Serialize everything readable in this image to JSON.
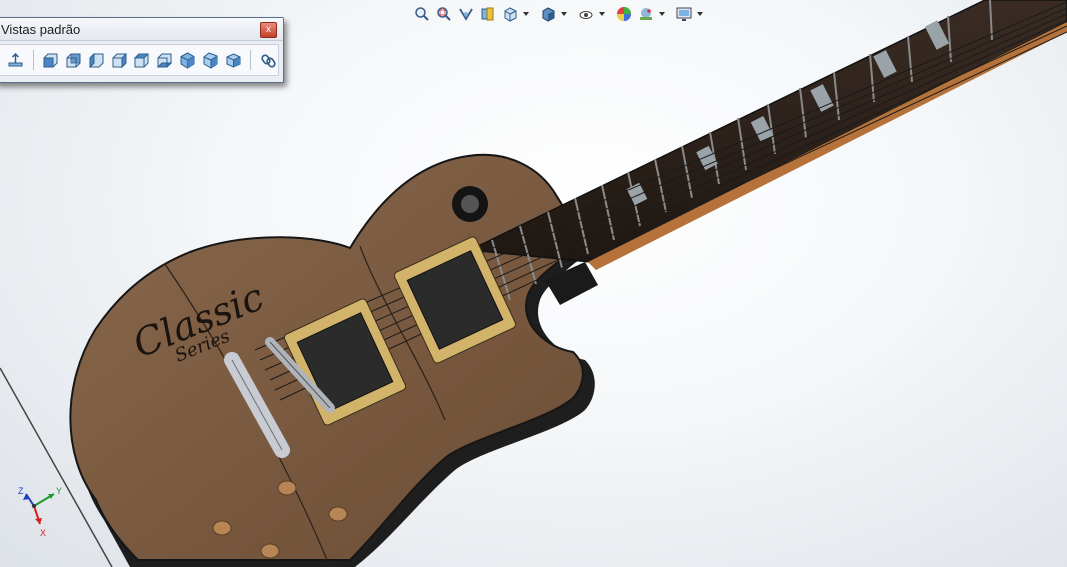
{
  "heads_up_toolbar": {
    "buttons": [
      {
        "name": "zoom-to-fit",
        "icon": "zoom-to-fit-icon"
      },
      {
        "name": "zoom-to-area",
        "icon": "zoom-to-area-icon"
      },
      {
        "name": "previous-view",
        "icon": "previous-view-icon"
      },
      {
        "name": "section-view",
        "icon": "section-view-icon"
      },
      {
        "name": "view-orientation",
        "icon": "view-orientation-icon",
        "has_menu": true
      },
      {
        "name": "display-style",
        "icon": "display-style-icon",
        "has_menu": true
      },
      {
        "name": "hide-show-items",
        "icon": "hide-show-items-icon",
        "has_menu": true
      },
      {
        "name": "edit-appearance",
        "icon": "edit-appearance-icon"
      },
      {
        "name": "apply-scene",
        "icon": "apply-scene-icon",
        "has_menu": true
      },
      {
        "name": "view-settings",
        "icon": "view-settings-icon",
        "has_menu": true
      }
    ]
  },
  "standard_views_panel": {
    "title": "Vistas padrão",
    "close_label": "x",
    "buttons": [
      {
        "name": "normal-to",
        "icon": "normal-to-icon"
      },
      {
        "name": "front-view",
        "icon": "front-view-icon"
      },
      {
        "name": "back-view",
        "icon": "back-view-icon"
      },
      {
        "name": "left-view",
        "icon": "left-view-icon"
      },
      {
        "name": "right-view",
        "icon": "right-view-icon"
      },
      {
        "name": "top-view",
        "icon": "top-view-icon"
      },
      {
        "name": "bottom-view",
        "icon": "bottom-view-icon"
      },
      {
        "name": "isometric-view",
        "icon": "isometric-view-icon"
      },
      {
        "name": "trimetric-view",
        "icon": "trimetric-view-icon"
      },
      {
        "name": "dimetric-view",
        "icon": "dimetric-view-icon"
      },
      {
        "name": "link-views",
        "icon": "link-views-icon"
      }
    ]
  },
  "model": {
    "logo_text": "Classic",
    "logo_subtext": "Series",
    "body_color": "#7a5a40",
    "binding_color": "#2a2a2a",
    "fretboard_color": "#2c211b"
  },
  "triad": {
    "x_label": "X",
    "y_label": "Y",
    "z_label": "Z",
    "x_color": "#d62020",
    "y_color": "#1f9a2a",
    "z_color": "#1c3fbf"
  }
}
